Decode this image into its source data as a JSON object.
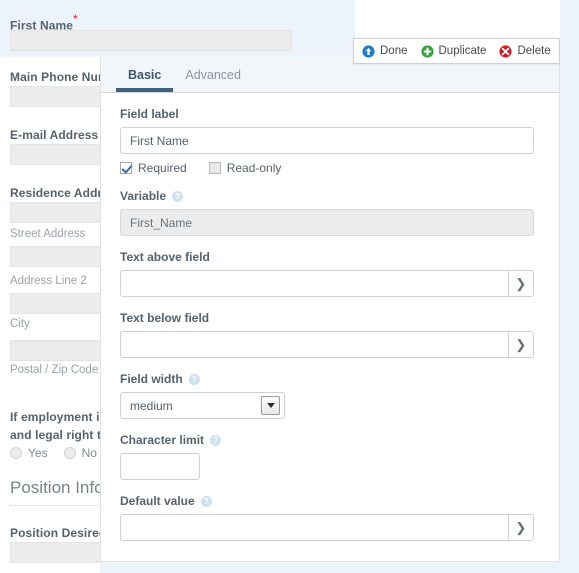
{
  "background_form": {
    "fields": [
      {
        "label": "First Name",
        "required": true,
        "highlighted": true
      },
      {
        "label": "Main Phone Number",
        "required": false
      },
      {
        "label": "E-mail Address",
        "required": false
      },
      {
        "label": "Residence Address",
        "required": false
      }
    ],
    "address_sublabels": [
      "Street Address",
      "Address Line 2",
      "City",
      "Postal / Zip Code"
    ],
    "question": {
      "line1": "If employment is offered, can you provide proof of identity",
      "line2": "and legal right to work in this country?",
      "options": [
        "Yes",
        "No"
      ]
    },
    "section_title": "Position Information",
    "position_label": "Position Desired",
    "required_marker": "*"
  },
  "action_bar": {
    "buttons": [
      {
        "label": "Done",
        "icon": "up-arrow-circle-icon",
        "color": "#1d7cc4"
      },
      {
        "label": "Duplicate",
        "icon": "plus-circle-icon",
        "color": "#35a23a"
      },
      {
        "label": "Delete",
        "icon": "x-circle-icon",
        "color": "#cc2027"
      }
    ]
  },
  "editor_panel": {
    "tabs": [
      {
        "label": "Basic",
        "active": true
      },
      {
        "label": "Advanced",
        "active": false
      }
    ],
    "active_tab_underline_color": "#3d6380",
    "fields": {
      "field_label": {
        "label": "Field label",
        "value": "First Name",
        "placeholder": ""
      },
      "required_checkbox": {
        "label": "Required",
        "checked": true
      },
      "readonly_checkbox": {
        "label": "Read-only",
        "checked": false
      },
      "variable": {
        "label": "Variable",
        "help": "?",
        "value": "First_Name",
        "disabled": true
      },
      "text_above_field": {
        "label": "Text above field",
        "value": "",
        "placeholder": "",
        "expand_icon": "chevron-right-icon"
      },
      "text_below_field": {
        "label": "Text below field",
        "value": "",
        "placeholder": "",
        "expand_icon": "chevron-right-icon"
      },
      "field_width": {
        "label": "Field width",
        "help": "?",
        "value": "medium",
        "options": [
          "medium"
        ]
      },
      "character_limit": {
        "label": "Character limit",
        "help": "?",
        "value": "",
        "placeholder": ""
      },
      "default_value": {
        "label": "Default value",
        "help": "?",
        "value": "",
        "placeholder": "",
        "expand_icon": "chevron-right-icon"
      }
    }
  }
}
